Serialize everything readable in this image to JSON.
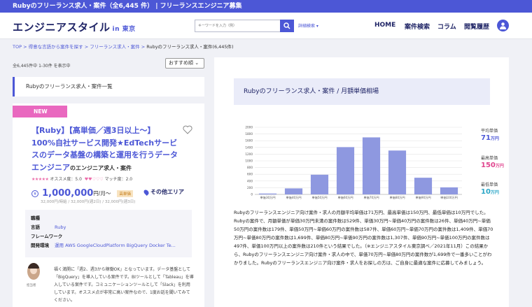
{
  "topbar": {
    "text": "Rubyのフリーランス求人・案件（全6,445 件） | フリーランスエンジニア募集"
  },
  "header": {
    "logo": "エンジニアスタイル",
    "logo_sub": "東京",
    "search_placeholder": "キーワードを入力（例）",
    "advanced_search": "詳細検索 ▾",
    "nav": [
      "HOME",
      "案件検索",
      "コラム",
      "閲覧履歴"
    ]
  },
  "breadcrumb": {
    "items": [
      "TOP",
      "得意な言語から案件を探す",
      "フリーランス求人・案件"
    ],
    "separator": ">",
    "current": "Rubyのフリーランス求人・案件(6,445件)"
  },
  "results": {
    "count_text": "全6,445件中 1-30件 を表示中",
    "sort_label": "おすすめ順 ⌄"
  },
  "list_heading": "Rubyのフリーランス求人・案件一覧",
  "job": {
    "new_label": "NEW",
    "title": "【Ruby】【高単価／週3日以上〜】100%自社サービス開発★EdTechサービスのデータ基盤の構築と運用を行うデータエンジニア",
    "company": "のエンジニア求人・案件",
    "recommend_label": "オススメ度：",
    "recommend_stars": "★★★★★",
    "recommend_value": "5.0",
    "match_label": "マッチ度：",
    "match_hearts": "♥♥♡♡♡",
    "match_value": "2.0",
    "price": "1,000,000",
    "price_unit": "円/月〜",
    "price_tag": "高単価",
    "location": "その他エリア",
    "price_sub": "32,000円/時給 / 32,000円(週2日) / 32,000円(週3日)",
    "info": [
      {
        "label": "職種",
        "value": ""
      },
      {
        "label": "言語",
        "value": "Ruby"
      },
      {
        "label": "フレームワーク",
        "value": ""
      },
      {
        "label": "開発環境",
        "value": "運用 AWS GoogleCloudPlatform BigQuery Docker Te..."
      }
    ],
    "advisor_name": "担当者",
    "advisor_comment": "福く満開に「週2、週3から稼働OK」となっています。データ基盤として「BigQuery」を導入している案件です。BIツールとして「Tableau」を導入している案件です。コミュニケーションツールとして「Slack」を利用しています。オススメ点が非常に高い案件なので、1度お話を聞いてみてください。"
  },
  "market": {
    "title": "Rubyのフリーランス求人・案件 / 月額単価相場",
    "avg_label": "平均単価",
    "avg_value": "71",
    "max_label": "最高単価",
    "max_value": "150",
    "min_label": "最低単価",
    "min_value": "10",
    "unit": "万円",
    "description": "Rubyのフリーランスエンジニア向け案件・求人の月額平均単価は71万円、最高単価は150万円、最低単価は10万円でした。Rubyの案件で、月額単価が単価30万円未満の案件数は529件、単価30万円~単価40万円の案件数は26件、単価40万円~単価50万円の案件数は179件、単価50万円~単価60万円の案件数は587件、単価60万円~単価70万円の案件数は1,409件、単価70万円~単価80万円の案件数は1,699件、単価80万円~単価90万円の案件数は1,307件、単価90万円~単価100万円の案件数は497件、単価100万円以上の案件数は210件という結果でした。（※エンジニアスタイル東京調べ／2021年11月）この結果から、Rubyのフリーランスエンジニア向け案件・求人の中で、単価70万円~単価80万円の案件数が1,699件で一番多いことがわかりました。Rubyのフリーランスエンジニア向け案件・求人をお探しの方は、ご自身に最適な案件に応募してみましょう。",
    "colors": {
      "accent": "#4c57d6",
      "avg": "#4c57d6",
      "max": "#e0458e",
      "min": "#2aa6c7"
    }
  },
  "chart_data": {
    "type": "bar",
    "categories": [
      "単価30万円",
      "単価40万円",
      "単価50万円",
      "単価60万円",
      "単価70万円",
      "単価80万円",
      "単価90万円",
      "単価100万円"
    ],
    "values": [
      26,
      179,
      587,
      1409,
      1699,
      1307,
      497,
      210
    ],
    "ylim": [
      0,
      2000
    ],
    "yticks": [
      0,
      200,
      400,
      600,
      800,
      1000,
      1200,
      1400,
      1600,
      1800,
      2000
    ],
    "grid": true
  }
}
